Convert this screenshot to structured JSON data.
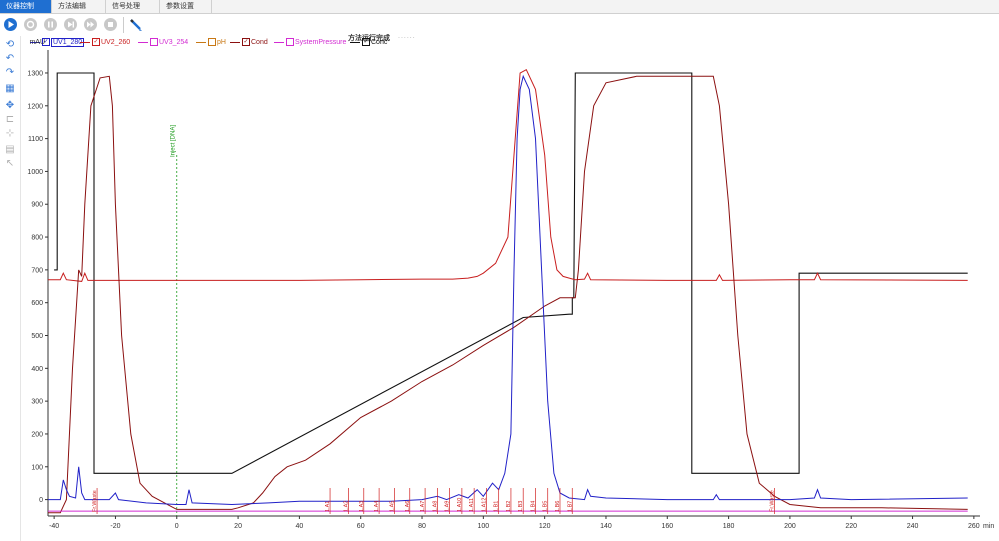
{
  "tabs": [
    {
      "label": "仪器控制",
      "active": true
    },
    {
      "label": "方法编辑",
      "active": false
    },
    {
      "label": "信号处理",
      "active": false
    },
    {
      "label": "参数设置",
      "active": false
    }
  ],
  "status": {
    "text": "方法运行完成",
    "dots": "......"
  },
  "toolbar": {
    "buttons": [
      "play-icon",
      "stop-icon",
      "pause-icon",
      "step-icon",
      "skip-icon",
      "end-icon",
      "pen-icon"
    ]
  },
  "sidebar": {
    "icons": [
      "refresh-icon",
      "undo-icon",
      "redo-icon",
      "grid-icon",
      "move-icon",
      "align-icon",
      "split-icon",
      "chart-edit-icon",
      "cursor-icon"
    ]
  },
  "legend": [
    {
      "name": "UV1_280",
      "color": "#2121c8",
      "checked": true
    },
    {
      "name": "UV2_260",
      "color": "#c81e1e",
      "checked": true
    },
    {
      "name": "UV3_254",
      "color": "#d22bd2",
      "checked": false
    },
    {
      "name": "pH",
      "color": "#c87814",
      "checked": false
    },
    {
      "name": "Cond",
      "color": "#8b1010",
      "checked": true
    },
    {
      "name": "SystemPressure",
      "color": "#d22bd2",
      "checked": false
    },
    {
      "name": "Conc",
      "color": "#111111",
      "checked": true
    }
  ],
  "chart_data": {
    "type": "line",
    "ylabel": "mAU",
    "xlabel": "min",
    "xlim": [
      -42,
      262
    ],
    "ylim": [
      -50,
      1370
    ],
    "x_ticks": [
      -40,
      -20,
      0,
      20,
      40,
      60,
      80,
      100,
      120,
      140,
      160,
      180,
      200,
      220,
      240,
      260
    ],
    "y_ticks": [
      0,
      100,
      200,
      300,
      400,
      500,
      600,
      700,
      800,
      900,
      1000,
      1100,
      1200,
      1300
    ],
    "inject_marker": {
      "x": 0,
      "label": "Inject [DNA]"
    },
    "fraction_labels": [
      {
        "x": -26,
        "label": "Fr.Waste"
      },
      {
        "x": 195,
        "label": "Fr.Waste"
      },
      {
        "x": 50,
        "label": "1.A1"
      },
      {
        "x": 56,
        "label": "1.A2"
      },
      {
        "x": 61,
        "label": "1.A3"
      },
      {
        "x": 66,
        "label": "1.A4"
      },
      {
        "x": 71,
        "label": "1.A5"
      },
      {
        "x": 76,
        "label": "1.A6"
      },
      {
        "x": 81,
        "label": "1.A7"
      },
      {
        "x": 85,
        "label": "1.A8"
      },
      {
        "x": 89,
        "label": "1.A9"
      },
      {
        "x": 93,
        "label": "1.A10"
      },
      {
        "x": 97,
        "label": "1.A11"
      },
      {
        "x": 101,
        "label": "1.A12"
      },
      {
        "x": 105,
        "label": "1.B1"
      },
      {
        "x": 109,
        "label": "1.B2"
      },
      {
        "x": 113,
        "label": "1.B3"
      },
      {
        "x": 117,
        "label": "1.B4"
      },
      {
        "x": 121,
        "label": "1.B5"
      },
      {
        "x": 125,
        "label": "1.B6"
      },
      {
        "x": 129,
        "label": "1.B7"
      }
    ],
    "series": [
      {
        "name": "Conc",
        "color": "#111111",
        "points": [
          [
            -40,
            700
          ],
          [
            -39,
            700
          ],
          [
            -39,
            1300
          ],
          [
            -27,
            1300
          ],
          [
            -27,
            80
          ],
          [
            18,
            80
          ],
          [
            113,
            555
          ],
          [
            128,
            565
          ],
          [
            129,
            565
          ],
          [
            129,
            615
          ],
          [
            129.5,
            615
          ],
          [
            130,
            1300
          ],
          [
            168,
            1300
          ],
          [
            168,
            80
          ],
          [
            203,
            80
          ],
          [
            203,
            690
          ],
          [
            258,
            690
          ]
        ]
      },
      {
        "name": "UV2_260",
        "color": "#c81e1e",
        "points": [
          [
            -42,
            670
          ],
          [
            -38,
            670
          ],
          [
            -37,
            690
          ],
          [
            -36,
            670
          ],
          [
            -31,
            665
          ],
          [
            -30,
            690
          ],
          [
            -29,
            668
          ],
          [
            -20,
            668
          ],
          [
            0,
            668
          ],
          [
            40,
            668
          ],
          [
            60,
            670
          ],
          [
            80,
            672
          ],
          [
            90,
            672
          ],
          [
            95,
            675
          ],
          [
            98,
            680
          ],
          [
            100,
            690
          ],
          [
            104,
            720
          ],
          [
            108,
            800
          ],
          [
            110,
            1050
          ],
          [
            112,
            1300
          ],
          [
            114,
            1310
          ],
          [
            117,
            1250
          ],
          [
            120,
            1050
          ],
          [
            122,
            800
          ],
          [
            124,
            700
          ],
          [
            126,
            680
          ],
          [
            128,
            675
          ],
          [
            130,
            670
          ],
          [
            133,
            672
          ],
          [
            134,
            690
          ],
          [
            135,
            670
          ],
          [
            160,
            668
          ],
          [
            176,
            668
          ],
          [
            177,
            685
          ],
          [
            178,
            668
          ],
          [
            200,
            670
          ],
          [
            208,
            670
          ],
          [
            209,
            690
          ],
          [
            210,
            670
          ],
          [
            258,
            668
          ]
        ]
      },
      {
        "name": "Cond",
        "color": "#8b1010",
        "points": [
          [
            -42,
            -40
          ],
          [
            -38,
            -40
          ],
          [
            -36,
            0
          ],
          [
            -34,
            400
          ],
          [
            -32,
            700
          ],
          [
            -31,
            680
          ],
          [
            -30,
            900
          ],
          [
            -28,
            1200
          ],
          [
            -25,
            1285
          ],
          [
            -22,
            1290
          ],
          [
            -21,
            1200
          ],
          [
            -20,
            900
          ],
          [
            -18,
            500
          ],
          [
            -15,
            200
          ],
          [
            -12,
            50
          ],
          [
            -8,
            10
          ],
          [
            -2,
            -20
          ],
          [
            0,
            -30
          ],
          [
            18,
            -30
          ],
          [
            20,
            -25
          ],
          [
            25,
            -10
          ],
          [
            28,
            20
          ],
          [
            32,
            70
          ],
          [
            36,
            100
          ],
          [
            42,
            120
          ],
          [
            50,
            170
          ],
          [
            60,
            250
          ],
          [
            70,
            300
          ],
          [
            80,
            360
          ],
          [
            90,
            410
          ],
          [
            100,
            470
          ],
          [
            110,
            525
          ],
          [
            120,
            590
          ],
          [
            125,
            615
          ],
          [
            130,
            615
          ],
          [
            131,
            700
          ],
          [
            133,
            1000
          ],
          [
            136,
            1200
          ],
          [
            140,
            1270
          ],
          [
            150,
            1290
          ],
          [
            168,
            1290
          ],
          [
            175,
            1290
          ],
          [
            177,
            1200
          ],
          [
            180,
            900
          ],
          [
            183,
            500
          ],
          [
            186,
            200
          ],
          [
            190,
            50
          ],
          [
            195,
            10
          ],
          [
            200,
            -15
          ],
          [
            210,
            -25
          ],
          [
            230,
            -25
          ],
          [
            258,
            -30
          ]
        ]
      },
      {
        "name": "UV1_280",
        "color": "#2121c8",
        "points": [
          [
            -42,
            0
          ],
          [
            -38,
            0
          ],
          [
            -37,
            60
          ],
          [
            -36,
            30
          ],
          [
            -35,
            10
          ],
          [
            -33,
            5
          ],
          [
            -32,
            100
          ],
          [
            -31,
            20
          ],
          [
            -30,
            0
          ],
          [
            -22,
            0
          ],
          [
            -20,
            20
          ],
          [
            -19,
            0
          ],
          [
            -10,
            -10
          ],
          [
            0,
            -15
          ],
          [
            3,
            -15
          ],
          [
            4,
            30
          ],
          [
            5,
            -10
          ],
          [
            18,
            -15
          ],
          [
            30,
            -10
          ],
          [
            40,
            -5
          ],
          [
            50,
            -5
          ],
          [
            60,
            -5
          ],
          [
            70,
            -5
          ],
          [
            80,
            0
          ],
          [
            85,
            10
          ],
          [
            88,
            0
          ],
          [
            92,
            15
          ],
          [
            95,
            5
          ],
          [
            98,
            30
          ],
          [
            100,
            10
          ],
          [
            103,
            50
          ],
          [
            105,
            30
          ],
          [
            107,
            80
          ],
          [
            109,
            200
          ],
          [
            110,
            700
          ],
          [
            111,
            1100
          ],
          [
            112,
            1250
          ],
          [
            113,
            1290
          ],
          [
            115,
            1250
          ],
          [
            117,
            1100
          ],
          [
            119,
            700
          ],
          [
            121,
            300
          ],
          [
            123,
            80
          ],
          [
            125,
            20
          ],
          [
            128,
            5
          ],
          [
            133,
            0
          ],
          [
            134,
            30
          ],
          [
            135,
            10
          ],
          [
            140,
            5
          ],
          [
            160,
            0
          ],
          [
            175,
            0
          ],
          [
            176,
            15
          ],
          [
            177,
            0
          ],
          [
            200,
            0
          ],
          [
            208,
            5
          ],
          [
            209,
            30
          ],
          [
            210,
            5
          ],
          [
            220,
            0
          ],
          [
            258,
            5
          ]
        ]
      },
      {
        "name": "UV3_254",
        "color": "#d22bd2",
        "points": [
          [
            -42,
            -35
          ],
          [
            258,
            -35
          ]
        ]
      }
    ]
  }
}
